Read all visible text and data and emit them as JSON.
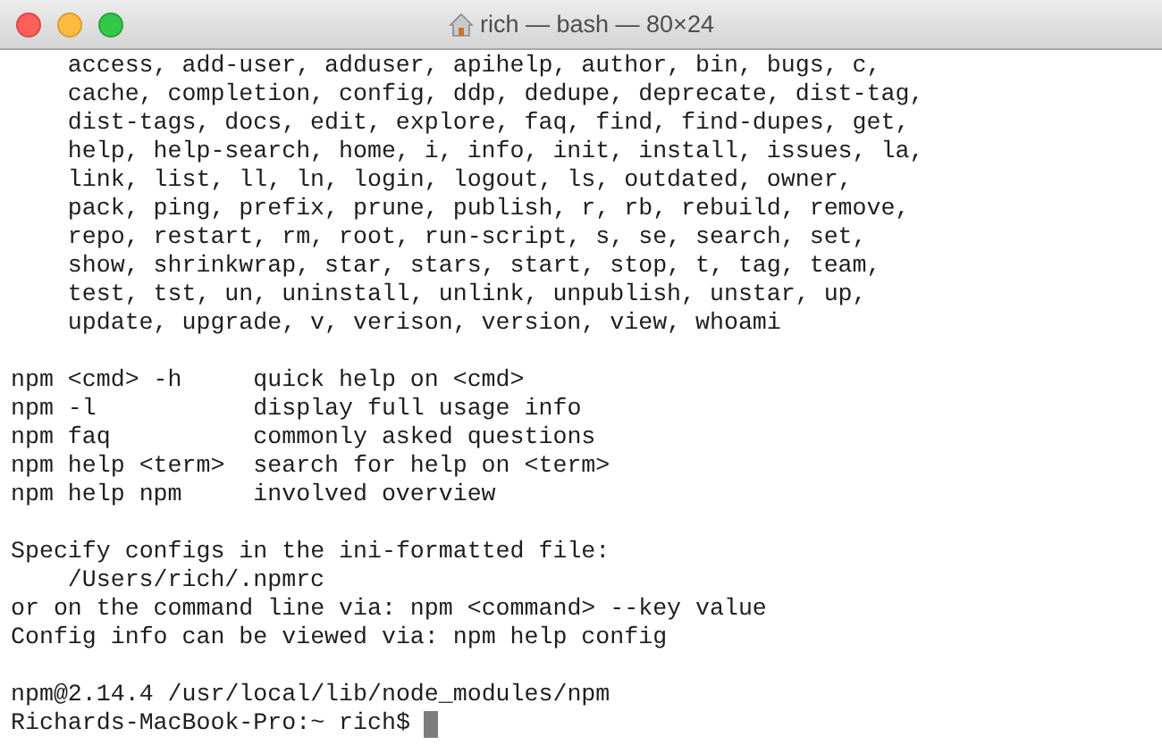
{
  "window": {
    "title": "rich — bash — 80×24"
  },
  "command_list": [
    "access, add-user, adduser, apihelp, author, bin, bugs, c,",
    "cache, completion, config, ddp, dedupe, deprecate, dist-tag,",
    "dist-tags, docs, edit, explore, faq, find, find-dupes, get,",
    "help, help-search, home, i, info, init, install, issues, la,",
    "link, list, ll, ln, login, logout, ls, outdated, owner,",
    "pack, ping, prefix, prune, publish, r, rb, rebuild, remove,",
    "repo, restart, rm, root, run-script, s, se, search, set,",
    "show, shrinkwrap, star, stars, start, stop, t, tag, team,",
    "test, tst, un, uninstall, unlink, unpublish, unstar, up,",
    "update, upgrade, v, verison, version, view, whoami"
  ],
  "help_rows": [
    {
      "command": "npm <cmd> -h",
      "description": "quick help on <cmd>"
    },
    {
      "command": "npm -l",
      "description": "display full usage info"
    },
    {
      "command": "npm faq",
      "description": "commonly asked questions"
    },
    {
      "command": "npm help <term>",
      "description": "search for help on <term>"
    },
    {
      "command": "npm help npm",
      "description": "involved overview"
    }
  ],
  "config_notes": [
    {
      "kind": "plain",
      "text": "Specify configs in the ini-formatted file:"
    },
    {
      "kind": "indented",
      "text": "/Users/rich/.npmrc"
    },
    {
      "kind": "plain",
      "text": "or on the command line via: npm <command> --key value"
    },
    {
      "kind": "plain",
      "text": "Config info can be viewed via: npm help config"
    }
  ],
  "version_line": "npm@2.14.4 /usr/local/lib/node_modules/npm",
  "prompt": "Richards-MacBook-Pro:~ rich$"
}
